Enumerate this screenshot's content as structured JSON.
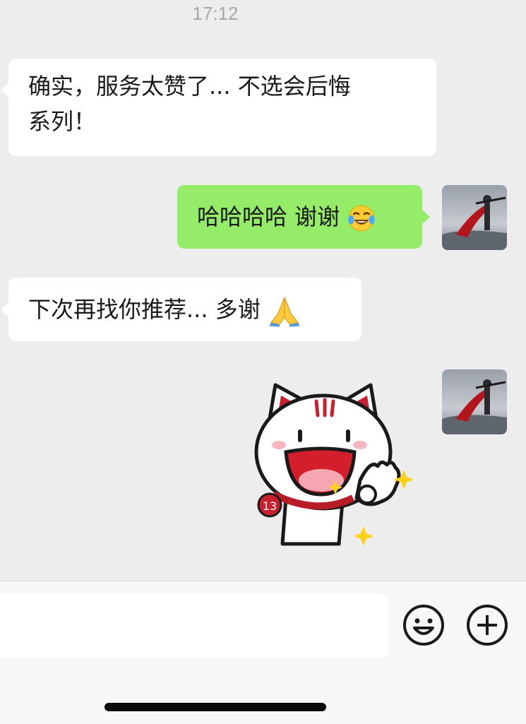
{
  "header": {
    "time": "17:12"
  },
  "messages": [
    {
      "direction": "incoming",
      "line1": "确实，服务太赞了... 不选会后悔",
      "line2": "系列！"
    },
    {
      "direction": "outgoing",
      "text": "哈哈哈哈 谢谢",
      "emoji": "tears-of-joy-emoji"
    },
    {
      "direction": "incoming",
      "text": "下次再找你推荐... 多谢",
      "emoji": "folded-hands-emoji"
    },
    {
      "direction": "outgoing",
      "sticker": "white-cat-ok-gesture-sticker",
      "sticker_badge": "13"
    }
  ],
  "input_bar": {
    "value": "",
    "icons": [
      "smiley-face-icon",
      "plus-circle-icon"
    ]
  },
  "colors": {
    "background": "#ededed",
    "incoming_bubble": "#ffffff",
    "outgoing_bubble": "#95ec69",
    "text": "#1a1a1a",
    "timestamp": "#a8a8a8"
  }
}
